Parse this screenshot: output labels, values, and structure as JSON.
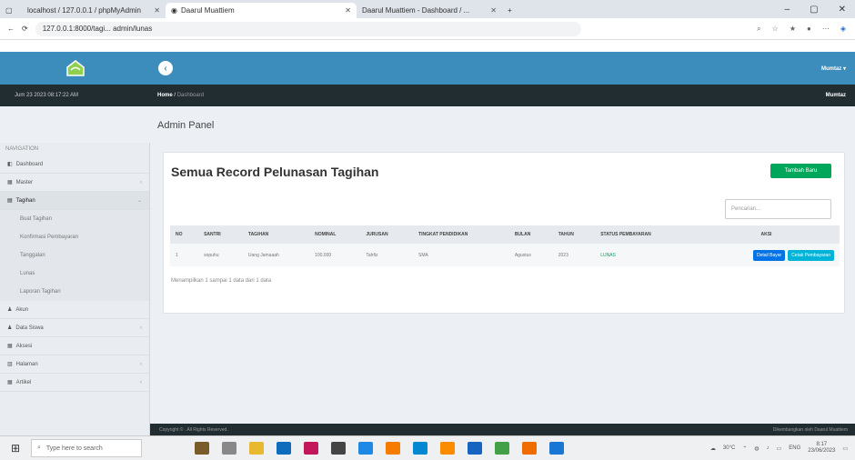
{
  "browser": {
    "tab1_title": "localhost / 127.0.0.1 / phpMyAdmin",
    "tab2_title": "Daarul Muattiem",
    "tab3_title": "Daarul Muattiem - Dashboard / ...",
    "url": "127.0.0.1:8000/tagi... admin/lunas"
  },
  "topnav": {
    "user": "Mumtaz"
  },
  "sidebar": {
    "date": "Jum 23 2023 08:17:22 AM",
    "header": "NAVIGATION",
    "items": [
      "Dashboard",
      "Master",
      "Tagihan"
    ],
    "sub_items": [
      "Buat Tagihan",
      "Konfirmasi Pembayaran",
      "Tanggalan",
      "Lunas",
      "Laporan Tagihan"
    ],
    "lower_items": [
      "Akun",
      "Data Siswa",
      "Aksesi",
      "Halaman",
      "Artikel"
    ]
  },
  "breadcrumb": {
    "home": "Home",
    "current": "Dashboard",
    "user": "Mumtaz"
  },
  "page_title": "Admin Panel",
  "card": {
    "title": "Semua Record Pelunasan Tagihan",
    "add_button": "Tambah Baru",
    "search_placeholder": "Pencarian..."
  },
  "table": {
    "headers": [
      "NO",
      "SANTRI",
      "TAGIHAN",
      "NOMINAL",
      "JURUSAN",
      "TINGKAT PENDIDIKAN",
      "BULAN",
      "TAHUN",
      "STATUS PEMBAYARAN",
      "AKSI"
    ],
    "rows": [
      {
        "no": "1",
        "santri": "sopuhu",
        "tagihan": "Uang Jamaaah",
        "nominal": "100.000",
        "jurusan": "Tahfiz",
        "tingkat": "SMA",
        "bulan": "Agustus",
        "tahun": "2023",
        "status": "LUNAS",
        "btn1": "Detail Bayar",
        "btn2": "Cetak Pembayaran"
      }
    ],
    "info": "Menampilkan 1 sampai 1 data dari 1 data"
  },
  "footer": {
    "left": "Copyright © . All Rights Reserved.",
    "right": "Dikembangkan oleh Daarul Muattiem"
  },
  "taskbar": {
    "search_placeholder": "Type here to search",
    "weather": "30°C",
    "time": "8:17",
    "date": "23/06/2023",
    "lang": "ENG"
  },
  "colors": {
    "primary": "#3c8dbc",
    "dark": "#222d32",
    "success": "#00a65a",
    "info": "#00b4d8",
    "link": "#0073e6"
  }
}
